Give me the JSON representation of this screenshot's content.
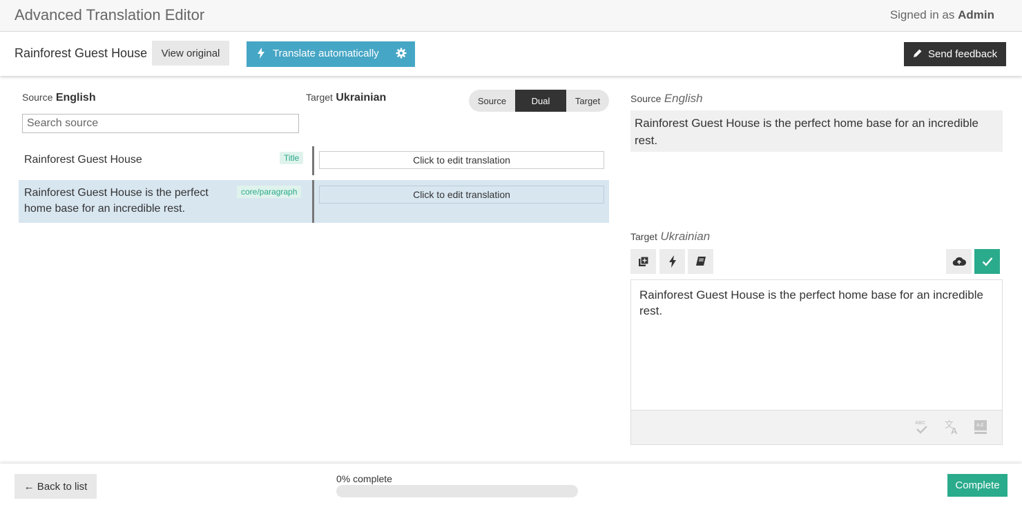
{
  "app": {
    "title": "Advanced Translation Editor",
    "signed_in_prefix": "Signed in as ",
    "user": "Admin"
  },
  "toolbar": {
    "document_title": "Rainforest Guest House",
    "view_original": "View original",
    "translate_auto": "Translate automatically",
    "send_feedback": "Send feedback"
  },
  "left": {
    "source_label": "Source",
    "source_lang": "English",
    "target_label": "Target",
    "target_lang": "Ukrainian",
    "search_placeholder": "Search source",
    "mode": {
      "source": "Source",
      "dual": "Dual",
      "target": "Target",
      "selected": "Dual"
    },
    "rows": [
      {
        "source": "Rainforest Guest House",
        "tag": "Title",
        "edit": "Click to edit translation"
      },
      {
        "source": "Rainforest Guest House is the perfect home base for an incredible rest.",
        "tag": "core/paragraph",
        "edit": "Click to edit translation"
      }
    ]
  },
  "right": {
    "source_label": "Source",
    "source_lang": "English",
    "source_text": "Rainforest Guest House is the perfect home base for an incredible rest.",
    "target_label": "Target",
    "target_lang": "Ukrainian",
    "target_text": "Rainforest Guest House is the perfect home base for an incredible rest."
  },
  "footer": {
    "back": "← Back to list",
    "progress_label": "0% complete",
    "progress_value": 0,
    "complete": "Complete"
  },
  "colors": {
    "accent_blue": "#46a6c5",
    "accent_green": "#2aab8c",
    "dark": "#333333",
    "selected_row": "#d8e6f0"
  }
}
